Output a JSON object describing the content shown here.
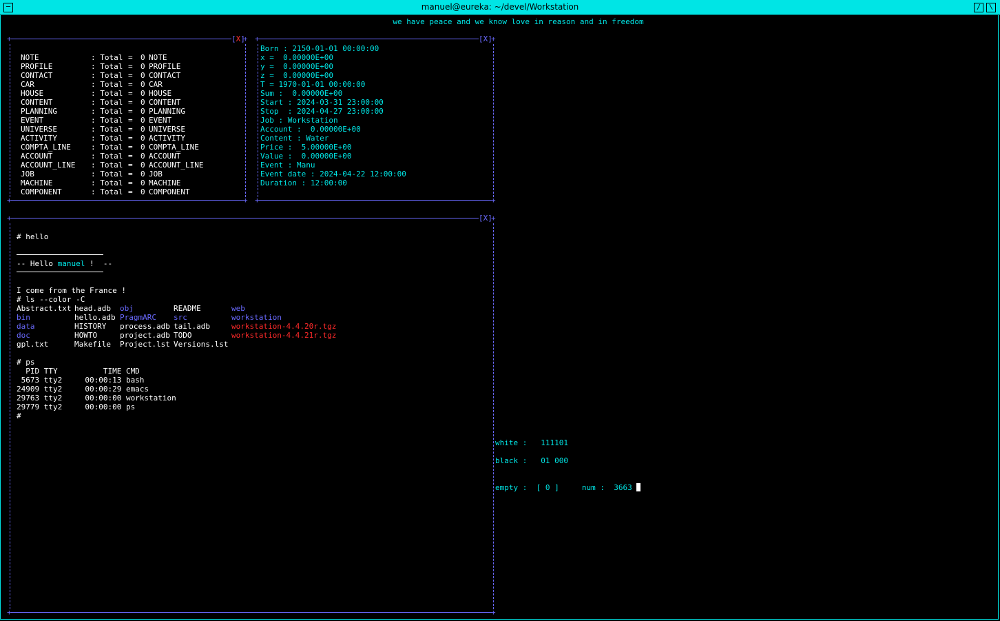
{
  "window": {
    "title": "manuel@eureka: ~/devel/Workstation",
    "menu_glyph": "─",
    "max_glyph": "/",
    "close_glyph": "\\",
    "motto": "we have peace and we know love in reason and in freedom"
  },
  "panels": {
    "close_label": "X",
    "bracket_open": "[",
    "bracket_close": "]"
  },
  "stats_panel": {
    "rows": [
      {
        "name": "NOTE",
        "label": ": Total",
        "eq": "=",
        "count": "0",
        "tag": "NOTE"
      },
      {
        "name": "PROFILE",
        "label": ": Total",
        "eq": "=",
        "count": "0",
        "tag": "PROFILE"
      },
      {
        "name": "CONTACT",
        "label": ": Total",
        "eq": "=",
        "count": "0",
        "tag": "CONTACT"
      },
      {
        "name": "CAR",
        "label": ": Total",
        "eq": "=",
        "count": "0",
        "tag": "CAR"
      },
      {
        "name": "HOUSE",
        "label": ": Total",
        "eq": "=",
        "count": "0",
        "tag": "HOUSE"
      },
      {
        "name": "CONTENT",
        "label": ": Total",
        "eq": "=",
        "count": "0",
        "tag": "CONTENT"
      },
      {
        "name": "PLANNING",
        "label": ": Total",
        "eq": "=",
        "count": "0",
        "tag": "PLANNING"
      },
      {
        "name": "EVENT",
        "label": ": Total",
        "eq": "=",
        "count": "0",
        "tag": "EVENT"
      },
      {
        "name": "UNIVERSE",
        "label": ": Total",
        "eq": "=",
        "count": "0",
        "tag": "UNIVERSE"
      },
      {
        "name": "ACTIVITY",
        "label": ": Total",
        "eq": "=",
        "count": "0",
        "tag": "ACTIVITY"
      },
      {
        "name": "COMPTA_LINE",
        "label": ": Total",
        "eq": "=",
        "count": "0",
        "tag": "COMPTA_LINE"
      },
      {
        "name": "ACCOUNT",
        "label": ": Total",
        "eq": "=",
        "count": "0",
        "tag": "ACCOUNT"
      },
      {
        "name": "ACCOUNT_LINE",
        "label": ": Total",
        "eq": "=",
        "count": "0",
        "tag": "ACCOUNT_LINE"
      },
      {
        "name": "JOB",
        "label": ": Total",
        "eq": "=",
        "count": "0",
        "tag": "JOB"
      },
      {
        "name": "MACHINE",
        "label": ": Total",
        "eq": "=",
        "count": "0",
        "tag": "MACHINE"
      },
      {
        "name": "COMPONENT",
        "label": ": Total",
        "eq": "=",
        "count": "0",
        "tag": "COMPONENT"
      }
    ]
  },
  "info_panel": {
    "lines": [
      "Born : 2150-01-01 00:00:00",
      "x =  0.00000E+00",
      "y =  0.00000E+00",
      "z =  0.00000E+00",
      "T = 1970-01-01 00:00:00",
      "Sum :  0.00000E+00",
      "Start : 2024-03-31 23:00:00",
      "Stop  : 2024-04-27 23:00:00",
      "Job : Workstation",
      "Account :  0.00000E+00",
      "Content : Water",
      "Price :  5.00000E+00",
      "Value :  0.00000E+00",
      "Event : Manu",
      "Event date : 2024-04-22 12:00:00",
      "Duration : 12:00:00"
    ]
  },
  "terminal": {
    "cmd_hello": "# hello",
    "hello_prefix": "-- Hello ",
    "hello_user": "manuel",
    "hello_suffix": " !  --",
    "france": "I come from the France !",
    "cmd_ls": "# ls --color -C",
    "ls_columns": [
      [
        {
          "t": "Abstract.txt",
          "c": "fg"
        },
        {
          "t": "bin",
          "c": "dir"
        },
        {
          "t": "data",
          "c": "dir"
        },
        {
          "t": "doc",
          "c": "dir"
        },
        {
          "t": "gpl.txt",
          "c": "fg"
        }
      ],
      [
        {
          "t": "head.adb",
          "c": "fg"
        },
        {
          "t": "hello.adb",
          "c": "fg"
        },
        {
          "t": "HISTORY",
          "c": "fg"
        },
        {
          "t": "HOWTO",
          "c": "fg"
        },
        {
          "t": "Makefile",
          "c": "fg"
        }
      ],
      [
        {
          "t": "obj",
          "c": "dir"
        },
        {
          "t": "PragmARC",
          "c": "dir"
        },
        {
          "t": "process.adb",
          "c": "fg"
        },
        {
          "t": "project.adb",
          "c": "fg"
        },
        {
          "t": "Project.lst",
          "c": "fg"
        }
      ],
      [
        {
          "t": "README",
          "c": "fg"
        },
        {
          "t": "src",
          "c": "dir"
        },
        {
          "t": "tail.adb",
          "c": "fg"
        },
        {
          "t": "TODO",
          "c": "fg"
        },
        {
          "t": "Versions.lst",
          "c": "fg"
        }
      ],
      [
        {
          "t": "web",
          "c": "dir"
        },
        {
          "t": "workstation",
          "c": "dir"
        },
        {
          "t": "workstation-4.4.20r.tgz",
          "c": "arc"
        },
        {
          "t": "workstation-4.4.21r.tgz",
          "c": "arc"
        }
      ]
    ],
    "cmd_ps": "# ps",
    "ps_lines": [
      "  PID TTY          TIME CMD",
      " 5673 tty2     00:00:13 bash",
      "24909 tty2     00:00:29 emacs",
      "29763 tty2     00:00:00 workstation",
      "29779 tty2     00:00:00 ps"
    ],
    "prompt": "#"
  },
  "status": {
    "white_label": "white :",
    "white_value": "111101",
    "black_label": "black :",
    "black_value": "01 000",
    "empty_label": "empty :",
    "empty_value": "[ 0 ]",
    "num_label": "num :",
    "num_value": "3663"
  },
  "colors": {
    "title_bar": "#00e5e5",
    "frame": "#6a6aff",
    "text_cyan": "#00e5e5",
    "text_white": "#ffffff",
    "dir_blue": "#6a6aff",
    "archive_red": "#ff2a2a",
    "close_red": "#ff3030"
  }
}
